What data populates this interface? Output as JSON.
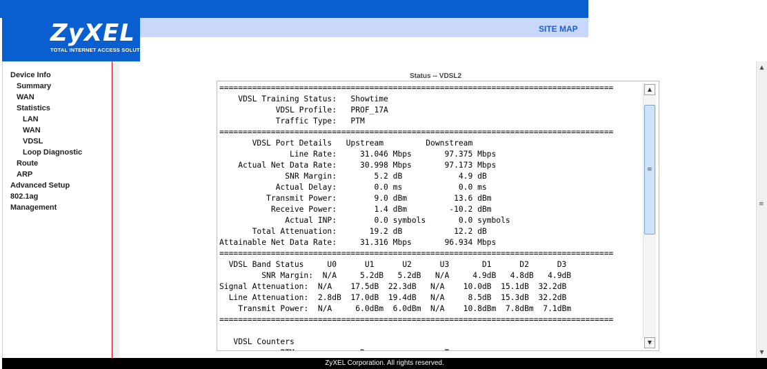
{
  "brand": {
    "logo": "ZyXEL",
    "tagline": "TOTAL INTERNET ACCESS SOLUTION",
    "site_map": "SITE MAP"
  },
  "sidebar": {
    "items": [
      {
        "label": "Device Info"
      },
      {
        "label": "Summary"
      },
      {
        "label": "WAN"
      },
      {
        "label": "Statistics"
      },
      {
        "label": "LAN"
      },
      {
        "label": "WAN"
      },
      {
        "label": "VDSL"
      },
      {
        "label": "Loop Diagnostic"
      },
      {
        "label": "Route"
      },
      {
        "label": "ARP"
      },
      {
        "label": "Advanced Setup"
      },
      {
        "label": "802.1ag"
      },
      {
        "label": "Management"
      }
    ]
  },
  "status": {
    "title": "Status -- VDSL2",
    "text": "====================================================================================\n    VDSL Training Status:   Showtime\n            VDSL Profile:   PROF_17A\n            Traffic Type:   PTM\n====================================================================================\n       VDSL Port Details   Upstream         Downstream\n               Line Rate:     31.046 Mbps       97.375 Mbps\n    Actual Net Data Rate:     30.998 Mbps       97.173 Mbps\n              SNR Margin:        5.2 dB            4.9 dB\n            Actual Delay:        0.0 ms            0.0 ms\n          Transmit Power:        9.0 dBm          13.6 dBm\n           Receive Power:        1.4 dBm         -10.2 dBm\n              Actual INP:        0.0 symbols       0.0 symbols\n       Total Attenuation:       19.2 dB           12.2 dB\nAttainable Net Data Rate:     31.316 Mbps       96.934 Mbps\n====================================================================================\n  VDSL Band Status     U0      U1      U2      U3       D1      D2      D3\n         SNR Margin:  N/A     5.2dB   5.2dB   N/A     4.9dB   4.8dB   4.9dB\nSignal Attenuation:  N/A    17.5dB  22.3dB   N/A    10.0dB  15.1dB  32.2dB\n  Line Attenuation:  2.8dB  17.0dB  19.4dB   N/A     8.5dB  15.3dB  32.2dB\n    Transmit Power:  N/A     6.0dBm  6.0dBm  N/A    10.8dBm  7.8dBm  7.1dBm\n====================================================================================\n\n   VDSL Counters\n             PTM              Rx                Tx"
  },
  "footer": {
    "copyright": "ZyXEL Corporation. All rights reserved."
  },
  "colors": {
    "header_blue": "#0a5fd0",
    "header_light": "#c8d8fa",
    "sidebar_divider": "#cc0000",
    "footer": "#000000"
  },
  "icons": {
    "scroll_up": "scroll-up-arrow-icon",
    "scroll_down": "scroll-down-arrow-icon",
    "scroll_grip": "scroll-grip-icon",
    "resize_grip": "resize-grip-icon"
  }
}
